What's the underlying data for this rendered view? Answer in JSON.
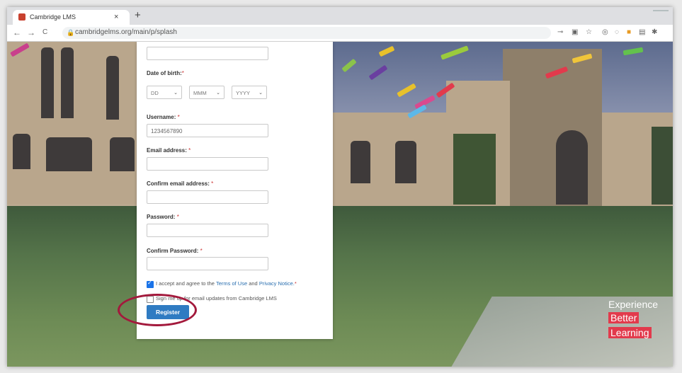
{
  "browser": {
    "tab_title": "Cambridge LMS",
    "tab_close": "×",
    "new_tab": "+",
    "back": "←",
    "forward": "→",
    "reload": "C",
    "url": "cambridgelms.org/main/p/splash"
  },
  "form": {
    "dob_label": "Date of birth:",
    "dob_day": "DD",
    "dob_month": "MMM",
    "dob_year": "YYYY",
    "username_label": "Username:",
    "username_value": "1234567890",
    "email_label": "Email address:",
    "confirm_email_label": "Confirm email address:",
    "password_label": "Password:",
    "confirm_password_label": "Confirm Password:",
    "required_mark": "*",
    "terms_prefix": "I accept and agree to the",
    "terms_link": "Terms of Use",
    "terms_and": "and",
    "privacy_link": "Privacy Notice.",
    "terms_checked": true,
    "updates_text": "Sign me up for email updates from Cambridge LMS",
    "updates_checked": false,
    "register_label": "Register"
  },
  "tagline": {
    "line1": "Experience",
    "line2": "Better",
    "line3": "Learning"
  },
  "colors": {
    "accent": "#a3193c",
    "button": "#2f7bc2",
    "tag_highlight": "#e23a4c"
  }
}
